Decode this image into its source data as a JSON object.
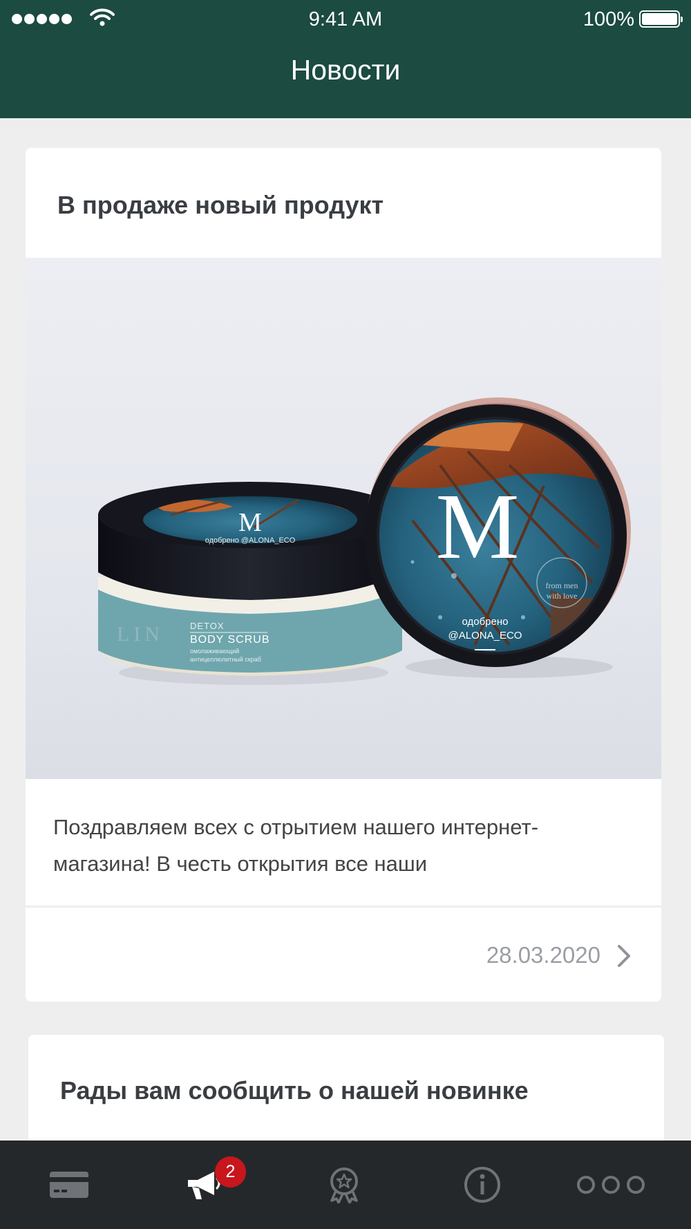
{
  "status_bar": {
    "time": "9:41 AM",
    "battery": "100%",
    "signal_icon": "signal-dots-icon",
    "wifi_icon": "wifi-icon",
    "battery_icon": "battery-icon"
  },
  "header": {
    "title": "Новости"
  },
  "news": [
    {
      "title": "В продаже новый продукт",
      "image": {
        "left_jar": {
          "label_small": "DETOX",
          "label_big": "BODY SCRUB",
          "label_sub1": "омолаживающий",
          "label_sub2": "антицеллюлитный скраб",
          "side_text": "LIN",
          "lid_text": "одобрено @ALONA_ECO"
        },
        "right_jar": {
          "logo": "M",
          "approved": "одобрено",
          "handle": "@ALONA_ECO",
          "stamp1": "from men",
          "stamp2": "with love"
        }
      },
      "text": "Поздравляем всех с отрытием нашего интернет-магазина! В честь открытия все наши",
      "date": "28.03.2020",
      "chevron_icon": "chevron-right-icon"
    },
    {
      "title": "Рады вам сообщить о нашей новинке"
    }
  ],
  "tabbar": {
    "tabs": [
      {
        "icon": "card-icon",
        "active": false
      },
      {
        "icon": "megaphone-icon",
        "active": true,
        "badge": "2"
      },
      {
        "icon": "award-icon",
        "active": false
      },
      {
        "icon": "info-icon",
        "active": false
      },
      {
        "icon": "more-icon",
        "active": false
      }
    ]
  },
  "colors": {
    "header": "#1b4b41",
    "tabbar": "#25282a",
    "badge": "#c8161d",
    "tab_inactive": "#6f7377",
    "tab_active": "#ffffff"
  }
}
